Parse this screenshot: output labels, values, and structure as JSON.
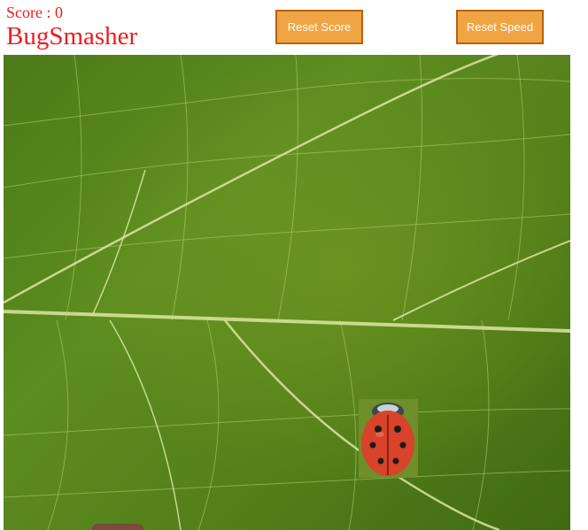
{
  "game": {
    "score_label": "Score : 0",
    "title": "BugSmasher"
  },
  "buttons": {
    "reset_score": "Reset Score",
    "reset_speed": "Reset Speed"
  },
  "board": {
    "background": "green leaf texture",
    "sprites": [
      "ladybug",
      "ladybug-partial"
    ]
  },
  "colors": {
    "title": "#ee1c1c",
    "button_bg": "#f0a544",
    "button_border": "#b95f12",
    "ladybug": "#d8432a"
  }
}
